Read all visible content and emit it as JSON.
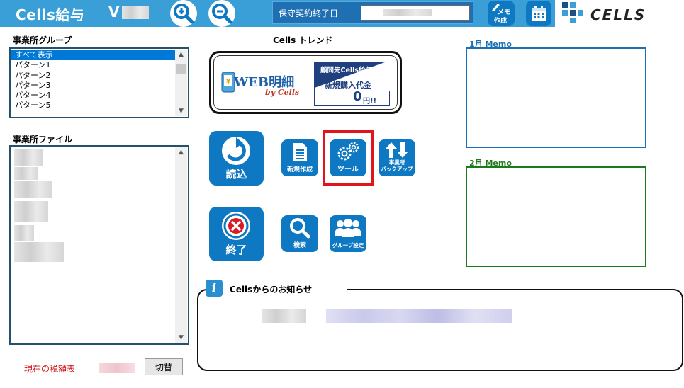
{
  "topbar": {
    "app_title": "Cells給与",
    "version_prefix": "V",
    "maintenance_label": "保守契約終了日",
    "memo_button_label_line1": "メモ",
    "memo_button_label_line2": "作成",
    "logo_text": "CELLS",
    "colors": {
      "bar": "#3a9fd6",
      "button": "#0e78c2"
    }
  },
  "office_group": {
    "label": "事業所グループ",
    "items": [
      "すべて表示",
      "パターン1",
      "パターン2",
      "パターン3",
      "パターン4",
      "パターン5"
    ],
    "selected_index": 0
  },
  "office_file": {
    "label": "事業所ファイル"
  },
  "trend": {
    "title": "Cells トレンド",
    "banner_left_main": "WEB明細",
    "banner_left_sub": "by Cells",
    "banner_right_line1": "顧問先Cells給与",
    "banner_right_line2": "新規購入代金",
    "banner_right_price": "0",
    "banner_right_unit": "円!!"
  },
  "tiles": {
    "read": "読込",
    "new_create": "新規作成",
    "tool": "ツール",
    "backup_line1": "事業所",
    "backup_line2": "バックアップ",
    "exit": "終了",
    "search": "検索",
    "group_setting": "グループ設定"
  },
  "notice": {
    "title": "Cellsからのお知らせ"
  },
  "memos": {
    "jan": "1月 Memo",
    "feb": "2月 Memo",
    "jan_color": "#1a6fb5",
    "feb_color": "#1b7a1b"
  },
  "footer": {
    "tax_table_label": "現在の税額表",
    "switch_button": "切替"
  }
}
